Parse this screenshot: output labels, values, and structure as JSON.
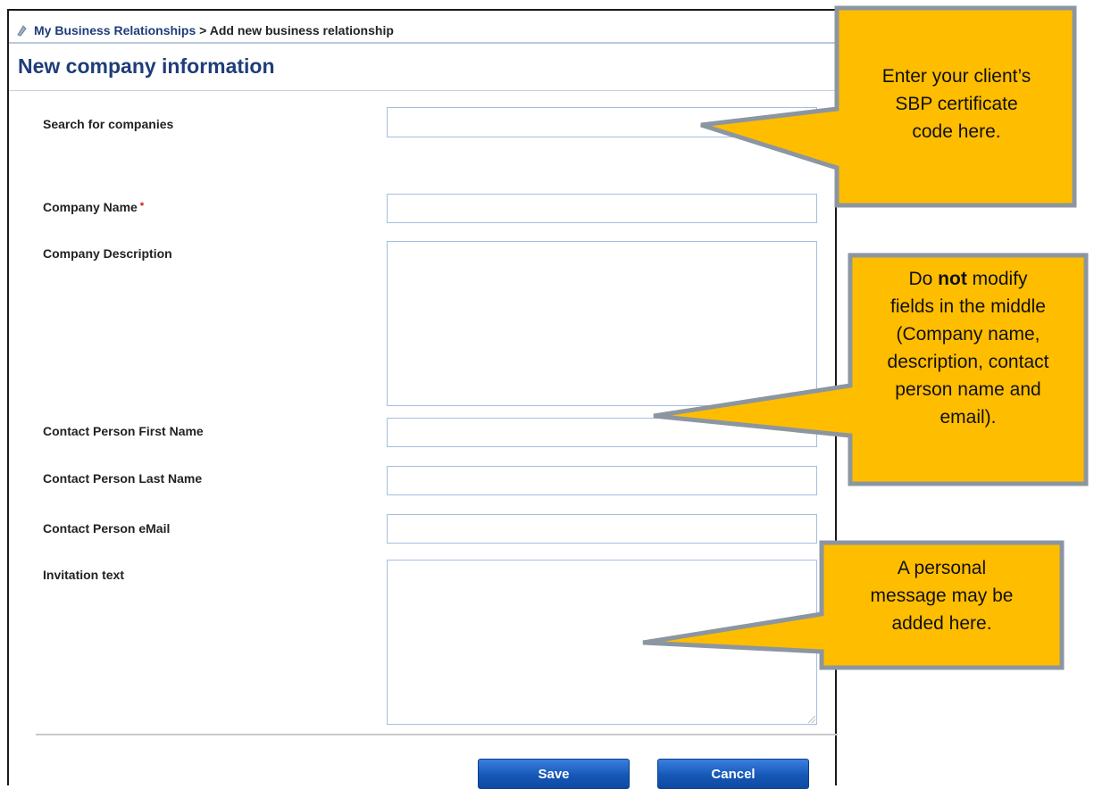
{
  "breadcrumb": {
    "link": "My Business Relationships",
    "separator": ">",
    "current": "Add new business relationship"
  },
  "page_title": "New company information",
  "form": {
    "search_label": "Search for companies",
    "company_name_label": "Company Name",
    "required_marker": "*",
    "company_description_label": "Company Description",
    "contact_first_name_label": "Contact Person First Name",
    "contact_last_name_label": "Contact Person Last Name",
    "contact_email_label": "Contact Person eMail",
    "invitation_text_label": "Invitation text"
  },
  "buttons": {
    "save": "Save",
    "cancel": "Cancel"
  },
  "callouts": {
    "certificate": {
      "line1": "Enter your client’s",
      "line2": "SBP certificate",
      "line3": "code here."
    },
    "middle_fields": {
      "line1_pre": "Do",
      "line1_bold": "not",
      "line1_post": "modify",
      "line2": "fields in the middle",
      "line3": "(Company name,",
      "line4": "description, contact",
      "line5": "person name and",
      "line6": "email)."
    },
    "personal_message": {
      "line1": "A personal",
      "line2": "message may be",
      "line3": "added here."
    }
  },
  "colors": {
    "callout_fill": "#FFBD00",
    "callout_border": "#8C96A0",
    "title_blue": "#1F3D7A",
    "button_blue": "#1558B8"
  },
  "icons": {
    "breadcrumb": "page-icon"
  }
}
